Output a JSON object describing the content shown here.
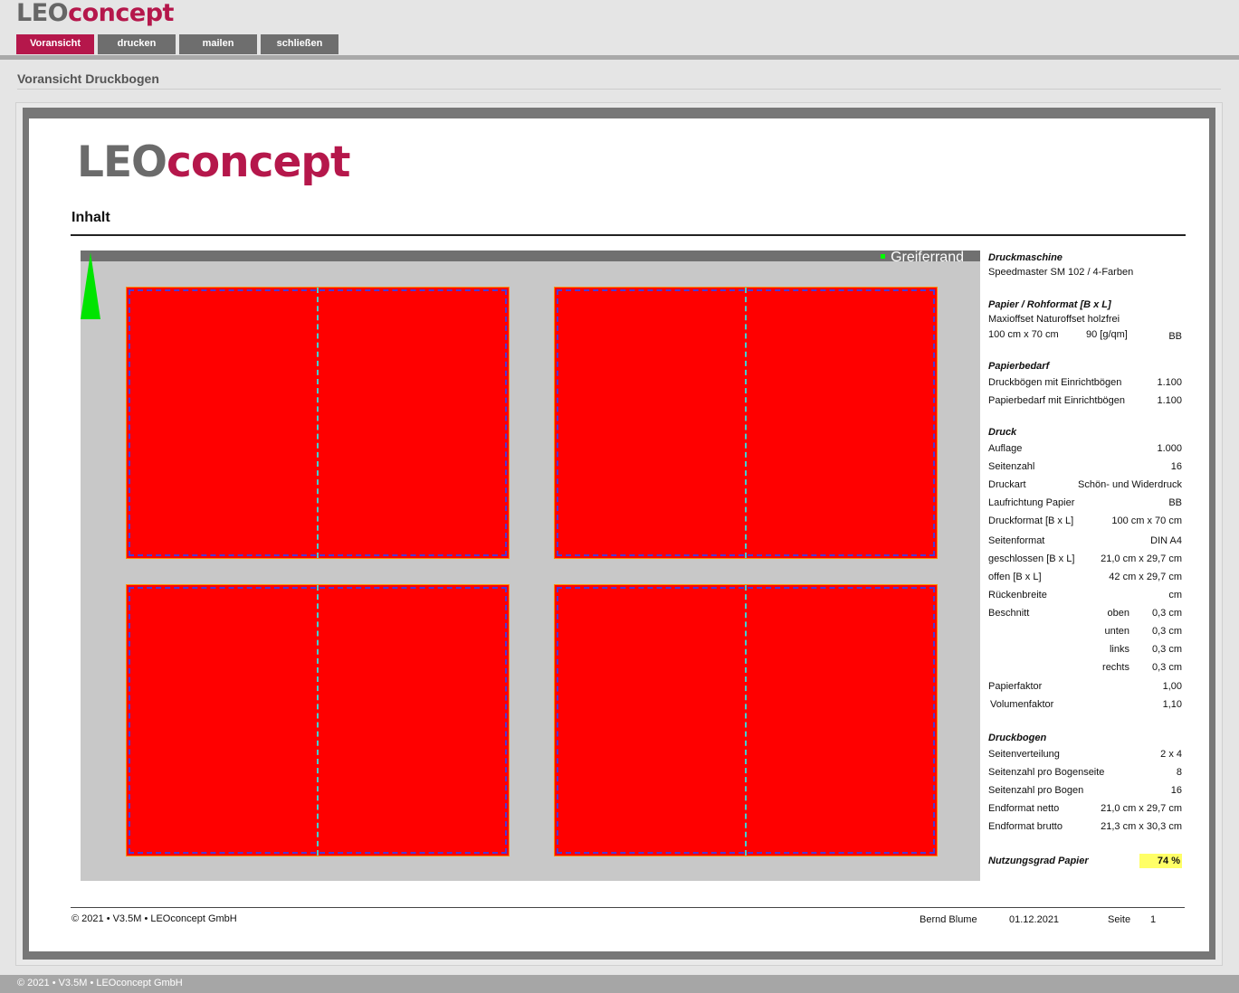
{
  "app": {
    "brand_leo": "LEO",
    "brand_concept": "concept",
    "brand_color": "#b5174b"
  },
  "nav": {
    "tabs": [
      "Voransicht",
      "drucken",
      "mailen",
      "schließen"
    ],
    "active": "Voransicht"
  },
  "page_title": "Voransicht Druckbogen",
  "doc": {
    "heading": "Inhalt",
    "sheet": {
      "greifer_label": "Greiferrand",
      "block_color": "#ff0000"
    },
    "info": {
      "druckmaschine": {
        "title": "Druckmaschine",
        "value": "Speedmaster SM 102 / 4-Farben"
      },
      "papier": {
        "title": "Papier / Rohformat [B x L]",
        "name": "Maxioffset Naturoffset holzfrei",
        "format": "100 cm  x  70 cm",
        "gramm": "90 [g/qm]",
        "lauf": "BB"
      },
      "papierbedarf": {
        "title": "Papierbedarf",
        "rows": [
          {
            "label": "Druckbögen mit Einrichtbögen",
            "value": "1.100"
          },
          {
            "label": "Papierbedarf mit Einrichtbögen",
            "value": "1.100"
          }
        ]
      },
      "druck": {
        "title": "Druck",
        "rows": [
          {
            "label": "Auflage",
            "value": "1.000"
          },
          {
            "label": "Seitenzahl",
            "value": "16"
          },
          {
            "label": "Druckart",
            "value": "Schön- und Widerdruck"
          },
          {
            "label": "Laufrichtung Papier",
            "value": "BB"
          },
          {
            "label": "Druckformat [B x L]",
            "value": "100 cm x 70 cm"
          },
          {
            "label": "Seitenformat",
            "value": "DIN A4"
          },
          {
            "label": "geschlossen [B x L]",
            "value": "21,0 cm x 29,7 cm"
          },
          {
            "label": "offen [B x L]",
            "value": "42 cm x 29,7 cm"
          },
          {
            "label": "Rückenbreite",
            "value": "cm"
          }
        ],
        "beschnitt_label": "Beschnitt",
        "beschnitt": [
          {
            "side": "oben",
            "value": "0,3 cm"
          },
          {
            "side": "unten",
            "value": "0,3 cm"
          },
          {
            "side": "links",
            "value": "0,3 cm"
          },
          {
            "side": "rechts",
            "value": "0,3 cm"
          }
        ],
        "faktoren": [
          {
            "label": "Papierfaktor",
            "value": "1,00"
          },
          {
            "label": "Volumenfaktor",
            "value": "1,10"
          }
        ]
      },
      "druckbogen": {
        "title": "Druckbogen",
        "rows": [
          {
            "label": "Seitenverteilung",
            "value": "2 x 4"
          },
          {
            "label": "Seitenzahl pro Bogenseite",
            "value": "8"
          },
          {
            "label": "Seitenzahl pro Bogen",
            "value": "16"
          },
          {
            "label": "Endformat netto",
            "value": "21,0 cm x 29,7 cm"
          },
          {
            "label": "Endformat brutto",
            "value": "21,3 cm x 30,3 cm"
          }
        ]
      },
      "nutzungsgrad": {
        "label": "Nutzungsgrad Papier",
        "value": "74 %"
      }
    },
    "footer": {
      "copyright": "© 2021 • V3.5M • LEOconcept GmbH",
      "user": "Bernd Blume",
      "date": "01.12.2021",
      "page_label": "Seite",
      "page_number": "1"
    }
  },
  "page_footer": "© 2021 • V3.5M • LEOconcept GmbH"
}
